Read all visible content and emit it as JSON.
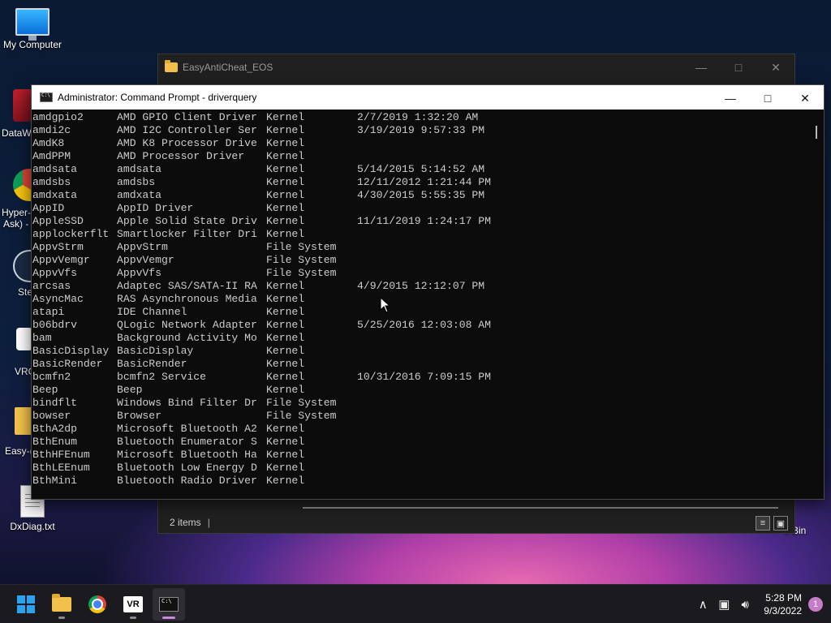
{
  "desktop": {
    "icons": [
      {
        "label": "My Computer"
      },
      {
        "label": "DxDiag.txt"
      }
    ],
    "partial_labels": [
      "DataW",
      "Hyper-",
      "Ask) -",
      "Ste",
      "VRC",
      "Easy-(",
      "e Bin"
    ]
  },
  "explorer": {
    "title": "EasyAntiCheat_EOS",
    "status_items": "2 items",
    "status_sep": "|"
  },
  "cmd": {
    "title": "Administrator: Command Prompt - driverquery",
    "rows": [
      [
        "amdgpio2",
        "AMD GPIO Client Driver",
        "Kernel",
        "2/7/2019 1:32:20 AM"
      ],
      [
        "amdi2c",
        "AMD I2C Controller Ser",
        "Kernel",
        "3/19/2019 9:57:33 PM"
      ],
      [
        "AmdK8",
        "AMD K8 Processor Drive",
        "Kernel",
        ""
      ],
      [
        "AmdPPM",
        "AMD Processor Driver",
        "Kernel",
        ""
      ],
      [
        "amdsata",
        "amdsata",
        "Kernel",
        "5/14/2015 5:14:52 AM"
      ],
      [
        "amdsbs",
        "amdsbs",
        "Kernel",
        "12/11/2012 1:21:44 PM"
      ],
      [
        "amdxata",
        "amdxata",
        "Kernel",
        "4/30/2015 5:55:35 PM"
      ],
      [
        "AppID",
        "AppID Driver",
        "Kernel",
        ""
      ],
      [
        "AppleSSD",
        "Apple Solid State Driv",
        "Kernel",
        "11/11/2019 1:24:17 PM"
      ],
      [
        "applockerflt",
        "Smartlocker Filter Dri",
        "Kernel",
        ""
      ],
      [
        "AppvStrm",
        "AppvStrm",
        "File System",
        ""
      ],
      [
        "AppvVemgr",
        "AppvVemgr",
        "File System",
        ""
      ],
      [
        "AppvVfs",
        "AppvVfs",
        "File System",
        ""
      ],
      [
        "arcsas",
        "Adaptec SAS/SATA-II RA",
        "Kernel",
        "4/9/2015 12:12:07 PM"
      ],
      [
        "AsyncMac",
        "RAS Asynchronous Media",
        "Kernel",
        ""
      ],
      [
        "atapi",
        "IDE Channel",
        "Kernel",
        ""
      ],
      [
        "b06bdrv",
        "QLogic Network Adapter",
        "Kernel",
        "5/25/2016 12:03:08 AM"
      ],
      [
        "bam",
        "Background Activity Mo",
        "Kernel",
        ""
      ],
      [
        "BasicDisplay",
        "BasicDisplay",
        "Kernel",
        ""
      ],
      [
        "BasicRender",
        "BasicRender",
        "Kernel",
        ""
      ],
      [
        "bcmfn2",
        "bcmfn2 Service",
        "Kernel",
        "10/31/2016 7:09:15 PM"
      ],
      [
        "Beep",
        "Beep",
        "Kernel",
        ""
      ],
      [
        "bindflt",
        "Windows Bind Filter Dr",
        "File System",
        ""
      ],
      [
        "bowser",
        "Browser",
        "File System",
        ""
      ],
      [
        "BthA2dp",
        "Microsoft Bluetooth A2",
        "Kernel",
        ""
      ],
      [
        "BthEnum",
        "Bluetooth Enumerator S",
        "Kernel",
        ""
      ],
      [
        "BthHFEnum",
        "Microsoft Bluetooth Ha",
        "Kernel",
        ""
      ],
      [
        "BthLEEnum",
        "Bluetooth Low Energy D",
        "Kernel",
        ""
      ],
      [
        "BthMini",
        "Bluetooth Radio Driver",
        "Kernel",
        ""
      ]
    ]
  },
  "taskbar": {
    "apps": [
      {
        "name": "start-button"
      },
      {
        "name": "file-explorer"
      },
      {
        "name": "chrome"
      },
      {
        "name": "vr",
        "glyph": "VR"
      },
      {
        "name": "terminal",
        "glyph": "C:\\"
      }
    ],
    "time": "5:28 PM",
    "date": "9/3/2022",
    "notification_count": "1"
  }
}
